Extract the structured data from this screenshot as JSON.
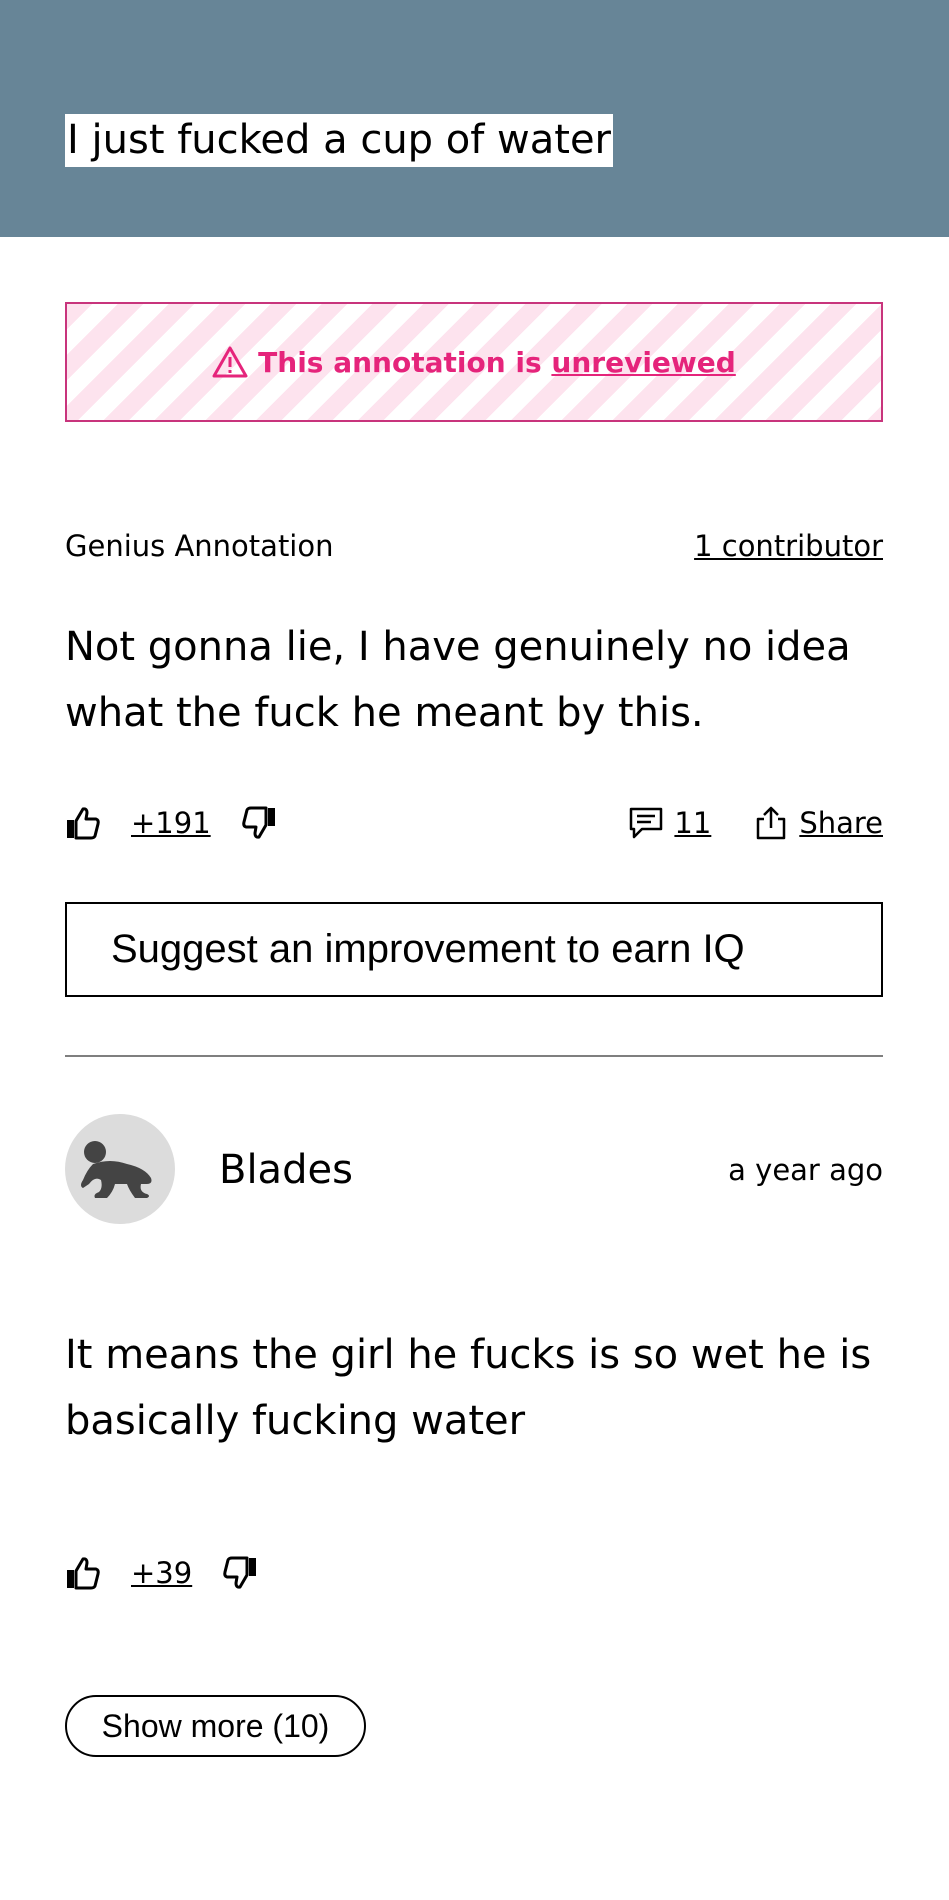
{
  "lyric": {
    "text": "I just fucked a cup of water"
  },
  "status_banner": {
    "prefix": "This annotation is ",
    "link": "unreviewed",
    "colors": {
      "text": "#e5247b",
      "border": "#c8347c",
      "stripe": "#fde3ee"
    },
    "icon": "warning-triangle-icon"
  },
  "annotation": {
    "label": "Genius Annotation",
    "contributors": "1 contributor",
    "body": "Not gonna lie, I have genuinely no idea what the fuck he meant by this.",
    "votes": "+191",
    "comments": "11",
    "share": "Share"
  },
  "suggest": {
    "label": "Suggest an improvement to earn IQ"
  },
  "comment": {
    "username": "Blades",
    "time": "a year ago",
    "body": "It means the girl he fucks is so wet he is basically fucking water",
    "votes": "+39",
    "avatar_icon": "crawling-baby-icon"
  },
  "show_more": {
    "label": "Show more (10)"
  },
  "colors": {
    "header_bg": "#678597",
    "divider": "#7f7f7f"
  }
}
